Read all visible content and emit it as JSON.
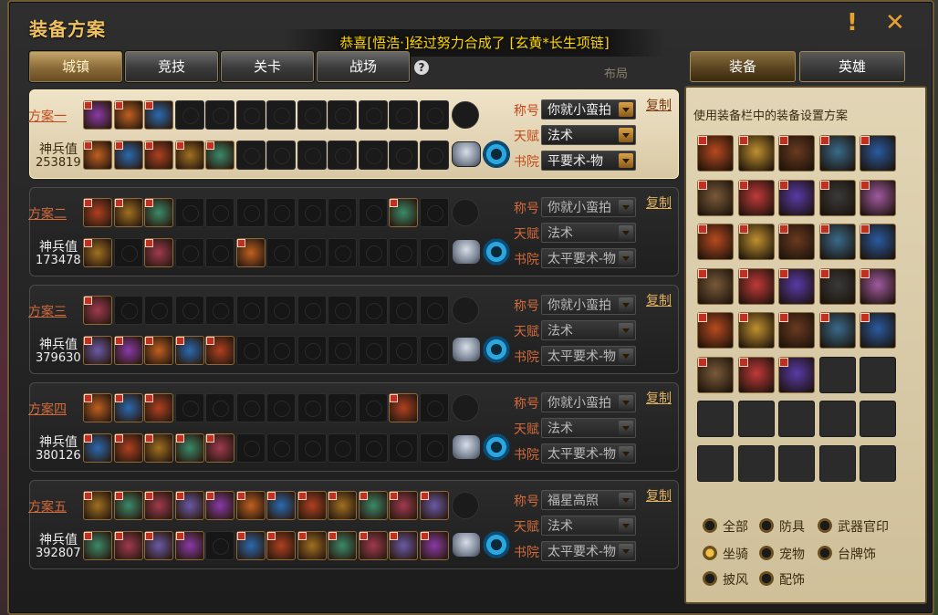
{
  "window": {
    "title": "装备方案",
    "banner": "恭喜[悟浩·]经过努力合成了 [玄黄*长生项链]",
    "help": "?",
    "close": "✕",
    "alert": "!",
    "bg_mark": "布局"
  },
  "tabs": [
    {
      "label": "城镇",
      "active": true
    },
    {
      "label": "竞技",
      "active": false
    },
    {
      "label": "关卡",
      "active": false
    },
    {
      "label": "战场",
      "active": false
    }
  ],
  "side_tabs": [
    {
      "label": "装备",
      "active": true
    },
    {
      "label": "英雄",
      "active": false
    }
  ],
  "field_labels": {
    "title": "称号",
    "talent": "天赋",
    "academy": "书院"
  },
  "power_label": "神兵值",
  "copy_label": "复制",
  "plans": [
    {
      "name": "方案一",
      "power": "253819",
      "title": "你就小蛮拍",
      "talent": "法术",
      "academy": "平要术-物",
      "selected": true,
      "row1": [
        1,
        1,
        1,
        0,
        0,
        0,
        0,
        0,
        0,
        0,
        0,
        0
      ],
      "row2": [
        1,
        1,
        1,
        1,
        1,
        0,
        0,
        0,
        0,
        0,
        0,
        0
      ]
    },
    {
      "name": "方案二",
      "power": "173478",
      "title": "你就小蛮拍",
      "talent": "法术",
      "academy": "太平要术-物",
      "selected": false,
      "row1": [
        1,
        1,
        1,
        0,
        0,
        0,
        0,
        0,
        0,
        0,
        1,
        0
      ],
      "row2": [
        1,
        0,
        1,
        0,
        0,
        1,
        0,
        0,
        0,
        0,
        0,
        0
      ]
    },
    {
      "name": "方案三",
      "power": "379630",
      "title": "你就小蛮拍",
      "talent": "法术",
      "academy": "太平要术-物",
      "selected": false,
      "row1": [
        1,
        0,
        0,
        0,
        0,
        0,
        0,
        0,
        0,
        0,
        0,
        0
      ],
      "row2": [
        1,
        1,
        1,
        1,
        1,
        0,
        0,
        0,
        0,
        0,
        0,
        0
      ]
    },
    {
      "name": "方案四",
      "power": "380126",
      "title": "你就小蛮拍",
      "talent": "法术",
      "academy": "太平要术-物",
      "selected": false,
      "row1": [
        1,
        1,
        1,
        0,
        0,
        0,
        0,
        0,
        0,
        0,
        1,
        0
      ],
      "row2": [
        1,
        1,
        1,
        1,
        1,
        0,
        0,
        0,
        0,
        0,
        0,
        0
      ]
    },
    {
      "name": "方案五",
      "power": "392807",
      "title": "福星高照",
      "talent": "法术",
      "academy": "太平要术-物",
      "selected": false,
      "row1": [
        1,
        1,
        1,
        1,
        1,
        1,
        1,
        1,
        1,
        1,
        1,
        1,
        1
      ],
      "row2": [
        1,
        1,
        1,
        1,
        0,
        1,
        1,
        1,
        1,
        1,
        1,
        1,
        1
      ]
    }
  ],
  "side_panel": {
    "hint": "使用装备栏中的装备设置方案",
    "inventory_filled": 28,
    "inventory_total": 40
  },
  "filters": [
    {
      "label": "全部",
      "on": false
    },
    {
      "label": "防具",
      "on": false
    },
    {
      "label": "武器官印",
      "on": false
    },
    {
      "label": "坐骑",
      "on": true
    },
    {
      "label": "宠物",
      "on": false
    },
    {
      "label": "台牌饰",
      "on": false
    },
    {
      "label": "披风",
      "on": false
    },
    {
      "label": "配饰",
      "on": false
    }
  ],
  "colors": {
    "accent": "#d26a3a",
    "gold": "#f0c060",
    "banner": "#ffd700"
  }
}
